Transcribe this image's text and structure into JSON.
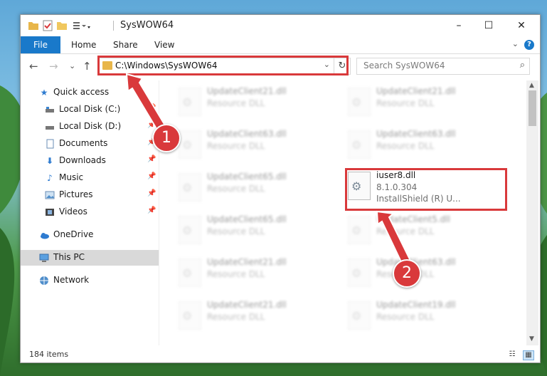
{
  "window": {
    "title": "SysWOW64",
    "minimize": "–",
    "maximize": "☐",
    "close": "✕"
  },
  "ribbon": {
    "tabs": [
      "File",
      "Home",
      "Share",
      "View"
    ],
    "help": "?"
  },
  "nav": {
    "back": "←",
    "forward": "→",
    "recent": "⌄",
    "up": "↑",
    "address": "C:\\Windows\\SysWOW64",
    "search_placeholder": "Search SysWOW64"
  },
  "sidebar": {
    "items": [
      {
        "label": "Quick access",
        "icon": "star-icon",
        "pinned": false
      },
      {
        "label": "Local Disk (C:)",
        "icon": "drive-icon",
        "pinned": true
      },
      {
        "label": "Local Disk (D:)",
        "icon": "drive-icon",
        "pinned": true
      },
      {
        "label": "Documents",
        "icon": "documents-icon",
        "pinned": true
      },
      {
        "label": "Downloads",
        "icon": "download-icon",
        "pinned": true
      },
      {
        "label": "Music",
        "icon": "music-icon",
        "pinned": true
      },
      {
        "label": "Pictures",
        "icon": "pictures-icon",
        "pinned": true
      },
      {
        "label": "Videos",
        "icon": "videos-icon",
        "pinned": true
      },
      {
        "label": "OneDrive",
        "icon": "cloud-icon",
        "pinned": false
      },
      {
        "label": "This PC",
        "icon": "computer-icon",
        "pinned": false
      },
      {
        "label": "Network",
        "icon": "network-icon",
        "pinned": false
      }
    ]
  },
  "files": [
    {
      "name": "UpdateClient21.dll",
      "type": "Resource DLL",
      "extra": ""
    },
    {
      "name": "UpdateClient21.dll",
      "type": "Resource DLL",
      "extra": ""
    },
    {
      "name": "UpdateClient63.dll",
      "type": "Resource DLL",
      "extra": ""
    },
    {
      "name": "UpdateClient63.dll",
      "type": "Resource DLL",
      "extra": ""
    },
    {
      "name": "UpdateClient65.dll",
      "type": "Resource DLL",
      "extra": ""
    },
    {
      "name": "iuser8.dll",
      "type": "8.1.0.304",
      "extra": "InstallShield (R) U..."
    },
    {
      "name": "UpdateClient65.dll",
      "type": "Resource DLL",
      "extra": ""
    },
    {
      "name": "UpdateClient5.dll",
      "type": "Resource DLL",
      "extra": ""
    },
    {
      "name": "UpdateClient21.dll",
      "type": "Resource DLL",
      "extra": ""
    },
    {
      "name": "UpdateClient63.dll",
      "type": "Resource DLL",
      "extra": ""
    },
    {
      "name": "UpdateClient21.dll",
      "type": "Resource DLL",
      "extra": ""
    },
    {
      "name": "UpdateClient19.dll",
      "type": "Resource DLL",
      "extra": ""
    }
  ],
  "status": {
    "item_count": "184 items"
  },
  "annotations": {
    "step1": "1",
    "step2": "2",
    "color": "#d9393b"
  }
}
